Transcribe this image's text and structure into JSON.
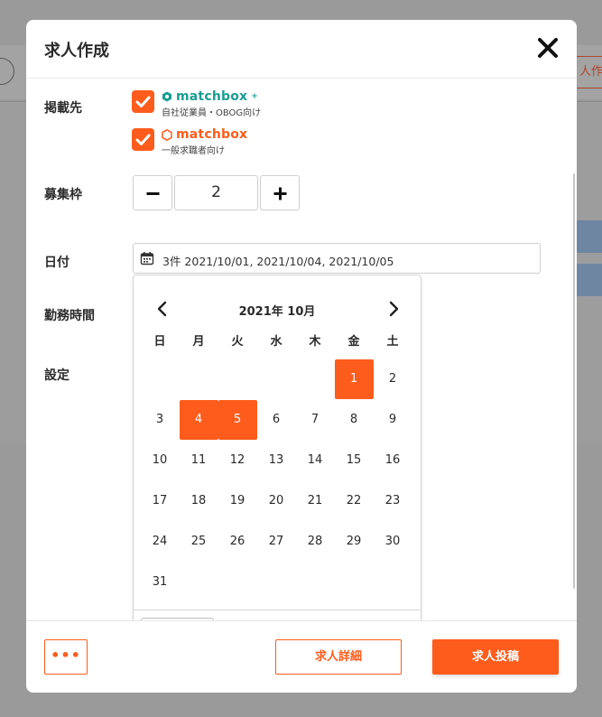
{
  "background": {
    "right_button_label": "人作成"
  },
  "modal": {
    "title": "求人作成"
  },
  "form": {
    "destination_label": "掲載先",
    "brand1": {
      "name": "matchbox",
      "sub": "自社従業員・OBOG向け",
      "color": "#1a9e92"
    },
    "brand2": {
      "name": "matchbox",
      "sub": "一般求職者向け",
      "color": "#fe5c1d"
    },
    "slots_label": "募集枠",
    "slots_value": "2",
    "date_label": "日付",
    "date_value": "3件 2021/10/01, 2021/10/04, 2021/10/05",
    "hours_label": "勤務時間",
    "settings_label": "設定"
  },
  "calendar": {
    "month_label": "2021年 10月",
    "weekdays": [
      "日",
      "月",
      "火",
      "水",
      "木",
      "金",
      "土"
    ],
    "days": [
      "1",
      "2",
      "3",
      "4",
      "5",
      "6",
      "7",
      "8",
      "9",
      "10",
      "11",
      "12",
      "13",
      "14",
      "15",
      "16",
      "17",
      "18",
      "19",
      "20",
      "21",
      "22",
      "23",
      "24",
      "25",
      "26",
      "27",
      "28",
      "29",
      "30",
      "31"
    ],
    "selected": [
      "1",
      "4",
      "5"
    ],
    "accent_color": "#fe5c1d"
  },
  "footer": {
    "more_label": "•••",
    "detail_label": "求人詳細",
    "post_label": "求人投稿"
  }
}
